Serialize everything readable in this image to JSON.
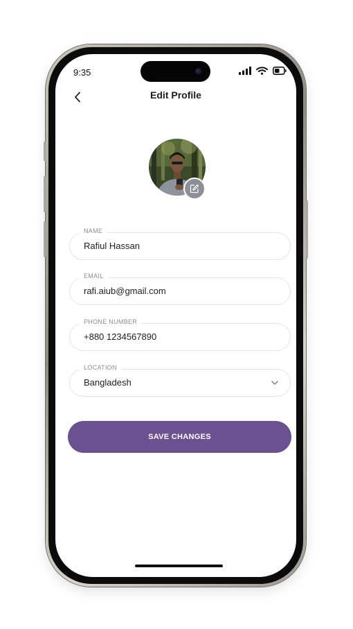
{
  "status_bar": {
    "time": "9:35",
    "icons": [
      "cellular-signal-icon",
      "wifi-icon",
      "battery-icon"
    ]
  },
  "header": {
    "title": "Edit Profile",
    "back_icon": "chevron-left-icon"
  },
  "avatar": {
    "edit_icon": "edit-icon"
  },
  "form": {
    "name": {
      "label": "NAME",
      "value": "Rafiul Hassan"
    },
    "email": {
      "label": "EMAIL",
      "value": "rafi.aiub@gmail.com"
    },
    "phone": {
      "label": "PHONE NUMBER",
      "value": "+880 1234567890"
    },
    "location": {
      "label": "LOCATION",
      "value": "Bangladesh",
      "dropdown_icon": "chevron-down-icon"
    }
  },
  "actions": {
    "save_label": "SAVE CHANGES"
  },
  "colors": {
    "accent": "#6a518f",
    "field_border": "#e4e4ea",
    "label": "#8a8a93",
    "edit_badge": "#8d8f96"
  }
}
